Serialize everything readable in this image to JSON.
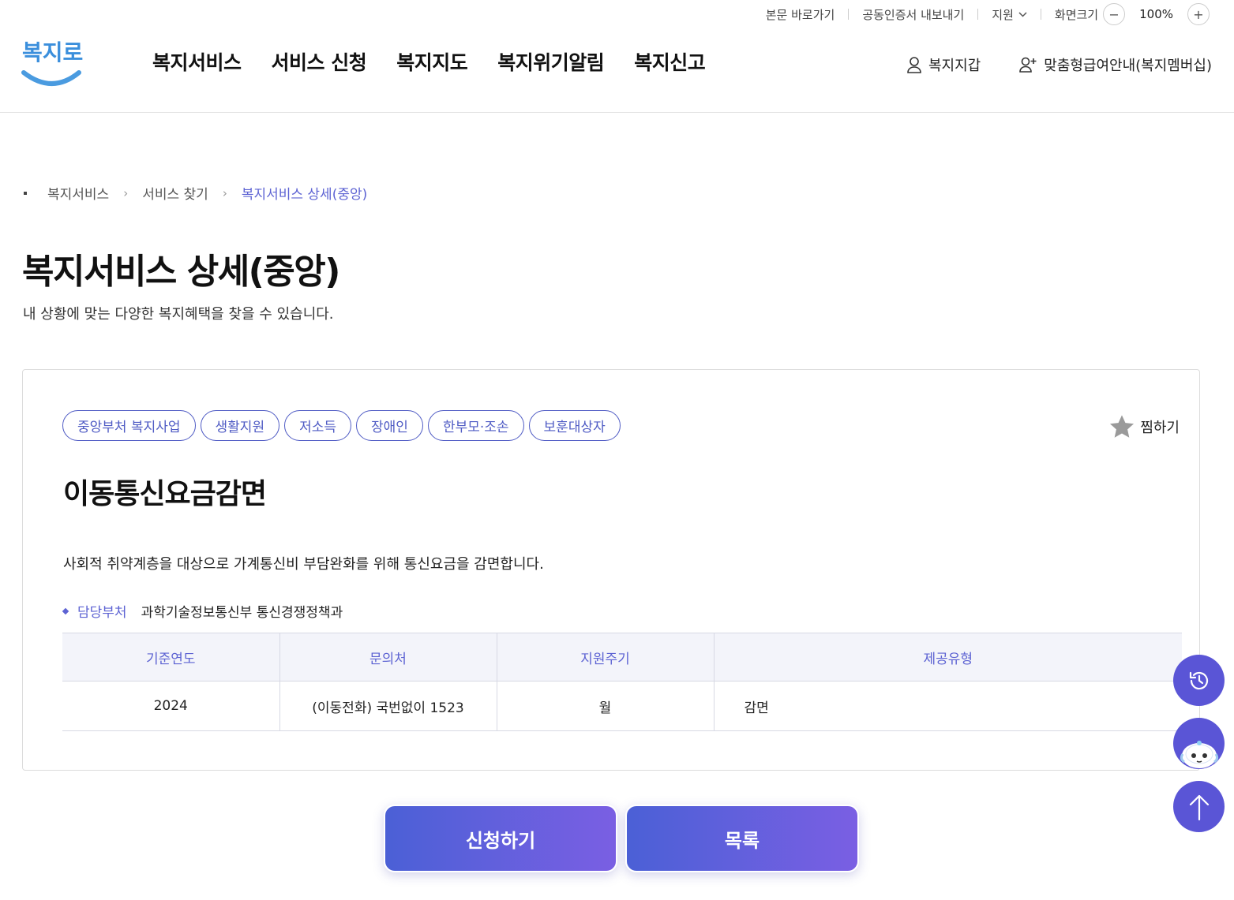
{
  "utility": {
    "skip_link": "본문 바로가기",
    "cert_export": "공동인증서 내보내기",
    "region": "지원",
    "screen_size_label": "화면크기",
    "zoom_minus": "−",
    "zoom_value": "100%",
    "zoom_plus": "+"
  },
  "header": {
    "logo_text": "복지로",
    "nav": [
      "복지서비스",
      "서비스 신청",
      "복지지도",
      "복지위기알림",
      "복지신고"
    ],
    "wallet": "복지지갑",
    "membership": "맞춤형급여안내(복지멤버십)"
  },
  "breadcrumb": [
    "복지서비스",
    "서비스 찾기",
    "복지서비스 상세(중앙)"
  ],
  "page": {
    "title": "복지서비스 상세(중앙)",
    "description": "내 상황에 맞는 다양한 복지혜택을 찾을 수 있습니다."
  },
  "service": {
    "tags": [
      "중앙부처 복지사업",
      "생활지원",
      "저소득",
      "장애인",
      "한부모·조손",
      "보훈대상자"
    ],
    "favorite_label": "찜하기",
    "title": "이동통신요금감면",
    "description": "사회적 취약계층을 대상으로 가계통신비 부담완화를 위해 통신요금을 감면합니다.",
    "dept_label": "담당부처",
    "dept_value": "과학기술정보통신부 통신경쟁정책과",
    "table": {
      "headers": [
        "기준연도",
        "문의처",
        "지원주기",
        "제공유형"
      ],
      "row": [
        "2024",
        "(이동전화) 국번없이 1523",
        "월",
        "감면"
      ]
    }
  },
  "buttons": {
    "apply": "신청하기",
    "list": "목록"
  },
  "colors": {
    "accent": "#5d63d3",
    "button_gradient_start": "#4b60d6",
    "button_gradient_end": "#7a5fe3",
    "logo_blue": "#4a9be0"
  }
}
